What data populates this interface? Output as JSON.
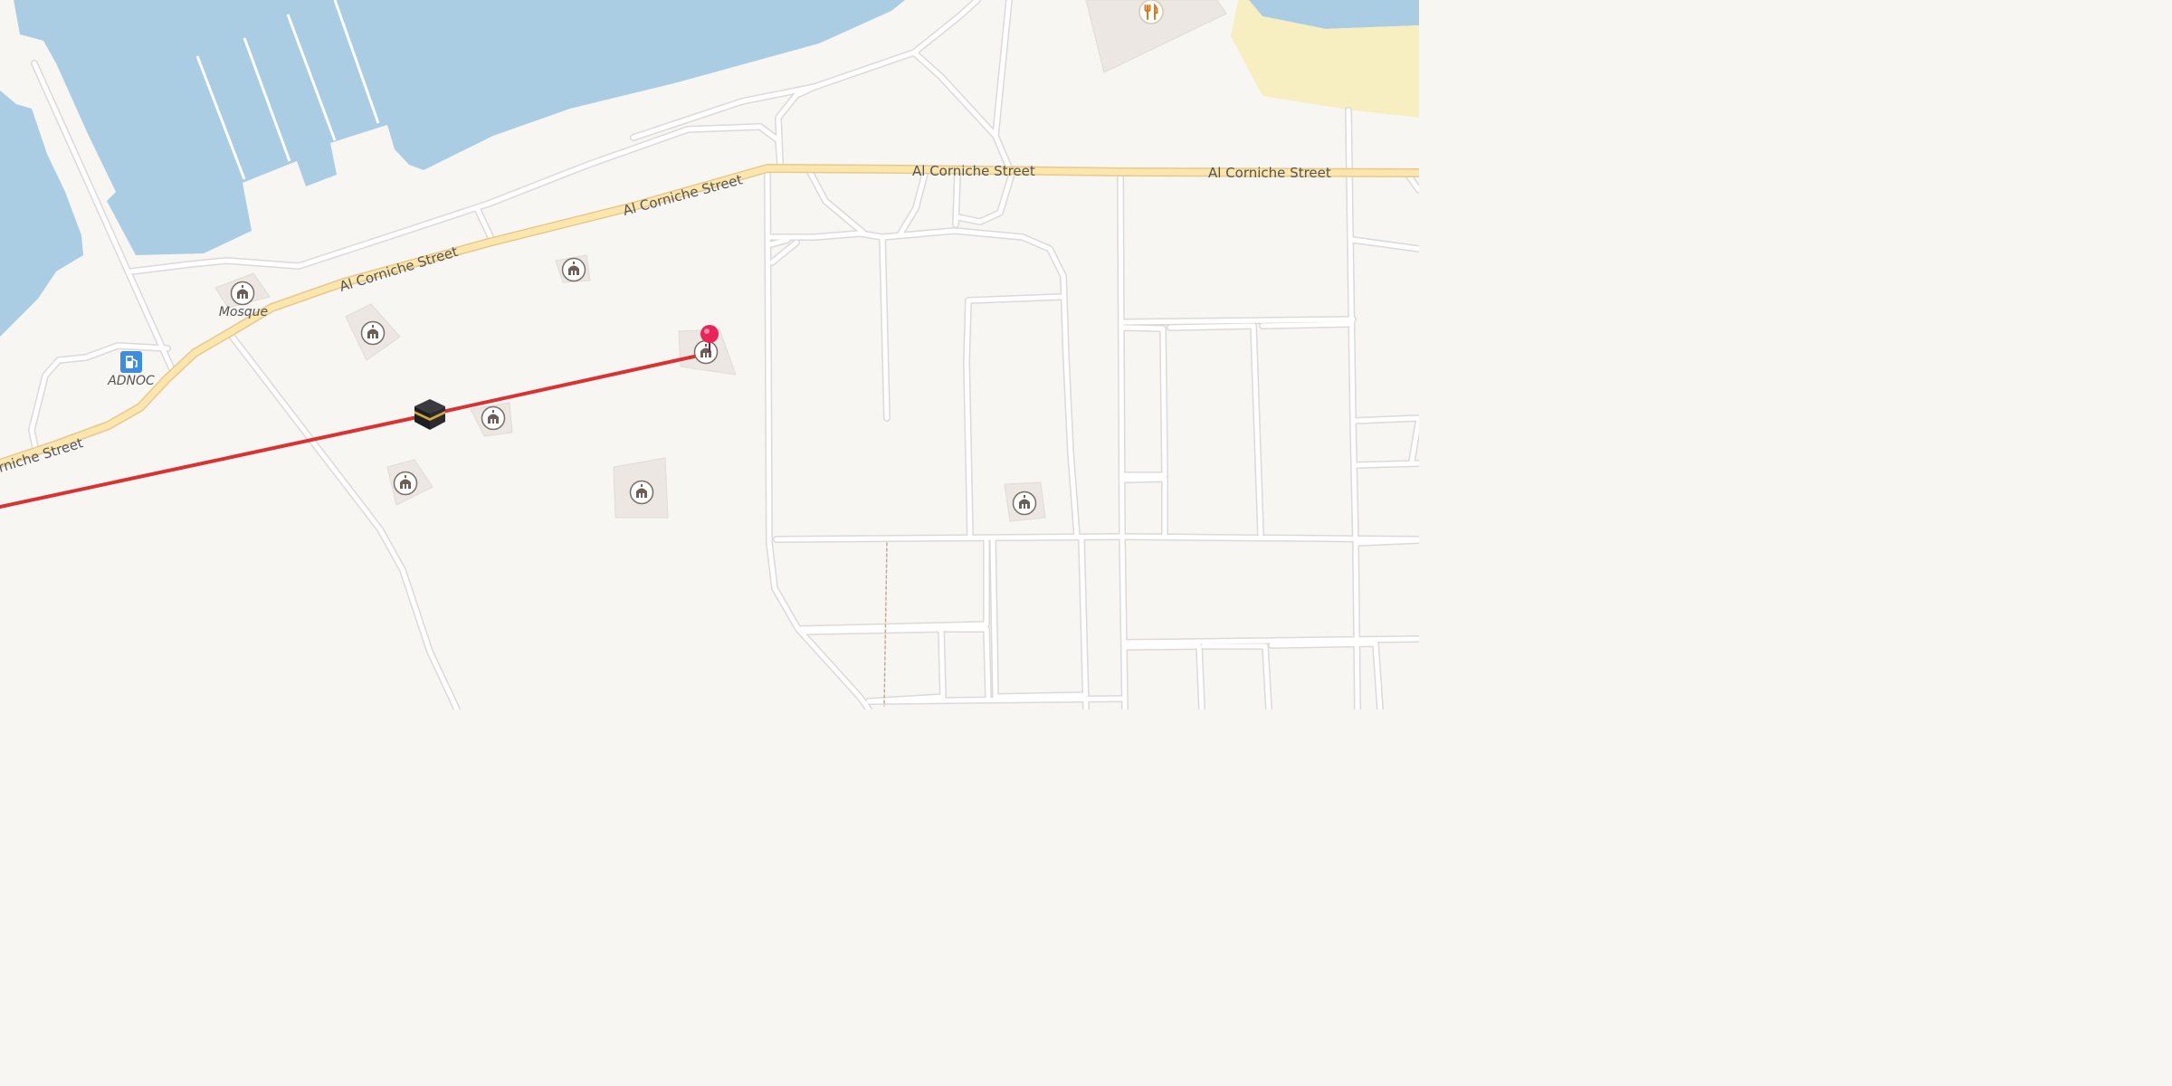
{
  "map": {
    "colors": {
      "land": "#f8f6f3",
      "water": "#abcde3",
      "beach": "#f7efc2",
      "road": "#ffffff",
      "road_casing": "#dcdad6",
      "main_road": "#fbe6ae",
      "main_road_casing": "#e8c98d",
      "route_line": "#d93232",
      "pin": "#e8245a",
      "fuel_icon": "#3d8de0",
      "poi_area": "#ece7e2"
    },
    "street_labels": [
      "Al Corniche Street",
      "Al Corniche Street",
      "Al Corniche Street",
      "Al Corniche Street",
      "rniche Street"
    ],
    "poi_labels": {
      "mosque": "Mosque",
      "fuel": "ADNOC"
    },
    "icons": {
      "mosque": "mosque-icon",
      "restaurant": "fork-knife-icon",
      "fuel": "fuel-pump-icon",
      "kaaba": "kaaba-icon",
      "pin": "location-pin-icon"
    }
  }
}
